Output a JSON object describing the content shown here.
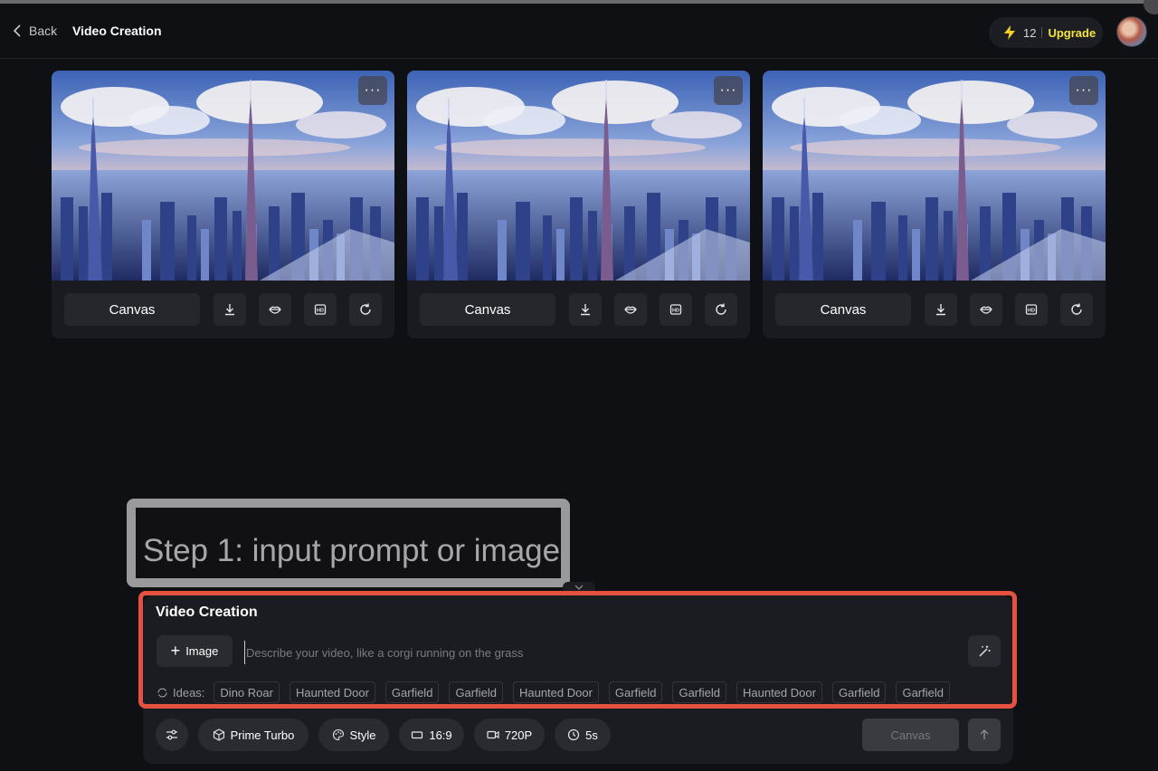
{
  "header": {
    "back_label": "Back",
    "title": "Video Creation",
    "credits": "12",
    "upgrade_label": "Upgrade"
  },
  "cards": [
    {
      "canvas_label": "Canvas",
      "more_label": "···"
    },
    {
      "canvas_label": "Canvas",
      "more_label": "···"
    },
    {
      "canvas_label": "Canvas",
      "more_label": "···"
    }
  ],
  "card_icons": [
    "download-icon",
    "lips-icon",
    "hd-icon",
    "refresh-icon"
  ],
  "step_overlay": {
    "text": "Step 1: input prompt or image"
  },
  "composer": {
    "title": "Video Creation",
    "image_button_label": "Image",
    "prompt_placeholder": "Describe your video, like a corgi running on the grass",
    "ideas_label": "Ideas:",
    "ideas": [
      "Dino Roar",
      "Haunted Door",
      "Garfield",
      "Garfield",
      "Haunted Door",
      "Garfield",
      "Garfield",
      "Haunted Door",
      "Garfield",
      "Garfield"
    ]
  },
  "toolbar": {
    "model": "Prime Turbo",
    "style": "Style",
    "aspect_ratio": "16:9",
    "resolution": "720P",
    "duration": "5s",
    "canvas_label": "Canvas"
  },
  "colors": {
    "background": "#0f1014",
    "upgrade": "#f5e43a",
    "highlight_border": "#e5503f",
    "overlay_border": "#9a9a9d"
  }
}
